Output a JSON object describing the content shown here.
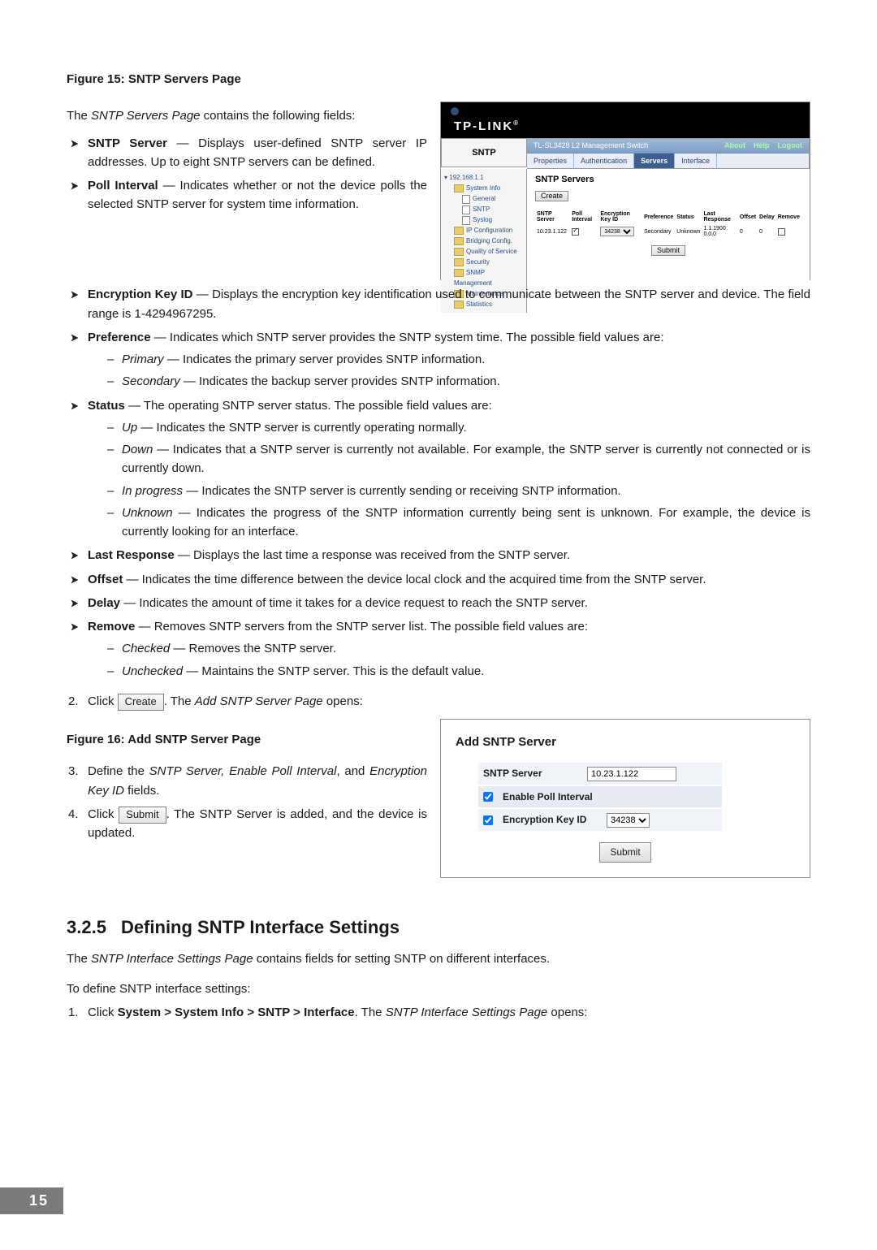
{
  "fig15_caption": "Figure 15: SNTP Servers Page",
  "intro1": "The SNTP Servers Page contains the following fields:",
  "bullets_top": {
    "server": {
      "t": "SNTP Server",
      "d": " — Displays user-defined SNTP server IP addresses. Up to eight SNTP servers can be defined."
    },
    "poll": {
      "t": "Poll Interval",
      "d": " — Indicates whether or not the device polls the selected SNTP server for system time information."
    }
  },
  "bullets_full": {
    "enc": {
      "t": "Encryption Key ID",
      "d": " — Displays the encryption key identification used to communicate between the SNTP server and device. The field range is 1-4294967295."
    },
    "pref": {
      "t": "Preference",
      "d": " — Indicates which SNTP server provides the SNTP system time. The possible field values are:",
      "sub": {
        "pri": {
          "t": "Primary",
          "d": " — Indicates the primary server provides SNTP information."
        },
        "sec": {
          "t": "Secondary",
          "d": " — Indicates the backup server provides SNTP information."
        }
      }
    },
    "status": {
      "t": "Status",
      "d": " — The operating SNTP server status. The possible field values are:",
      "sub": {
        "up": {
          "t": "Up",
          "d": " — Indicates the SNTP server is currently operating normally."
        },
        "down": {
          "t": "Down",
          "d": " — Indicates that a SNTP server is currently not available. For example, the SNTP server is currently not connected or is currently down."
        },
        "prog": {
          "t": "In progress",
          "d": " — Indicates the SNTP server is currently sending or receiving SNTP information."
        },
        "unk": {
          "t": "Unknown",
          "d": " — Indicates the progress of the SNTP information currently being sent is unknown. For example, the device is currently looking for an interface."
        }
      }
    },
    "last": {
      "t": "Last Response",
      "d": " — Displays the last time a response was received from the SNTP server."
    },
    "off": {
      "t": "Offset",
      "d": " — Indicates the time difference between the device local clock and the acquired time from the SNTP server."
    },
    "delay": {
      "t": "Delay",
      "d": " — Indicates the amount of time it takes for a device request to reach the SNTP server."
    },
    "rem": {
      "t": "Remove",
      "d": " — Removes SNTP servers from the SNTP server list. The possible field values are:",
      "sub": {
        "ch": {
          "t": "Checked",
          "d": " — Removes the SNTP server."
        },
        "un": {
          "t": "Unchecked",
          "d": " — Maintains the SNTP server. This is the default value."
        }
      }
    }
  },
  "step2": {
    "num": "2.",
    "pre": "Click ",
    "btn": "Create",
    "post": ". The Add SNTP Server Page opens:"
  },
  "fig16_caption": "Figure 16: Add SNTP Server Page",
  "step3": {
    "num": "3.",
    "text1": "Define the ",
    "em": "SNTP Server, Enable Poll Interval",
    "text2": ", and ",
    "em2": "Encryption Key ID",
    "text3": " fields."
  },
  "step4": {
    "num": "4.",
    "pre": "Click ",
    "btn": "Submit",
    "post": ". The SNTP Server is added, and the device is updated."
  },
  "section": {
    "num": "3.2.5",
    "title": "Defining SNTP Interface Settings"
  },
  "sec_body1": "The SNTP Interface Settings Page contains fields for setting SNTP on different interfaces.",
  "sec_body2": "To define SNTP interface settings:",
  "step1b": {
    "num": "1.",
    "pre": "Click ",
    "bold": "System > System Info > SNTP > Interface",
    "post": ". The SNTP Interface Settings Page opens:"
  },
  "page_number": "15",
  "shot1": {
    "brand": "TP-LINK",
    "side_label": "SNTP",
    "model": "TL-SL3428 L2 Management Switch",
    "links": {
      "about": "About",
      "help": "Help",
      "logout": "Logout"
    },
    "tabs": [
      "Properties",
      "Authentication",
      "Servers",
      "Interface"
    ],
    "active_tab_idx": 2,
    "tree": {
      "root": "192.168.1.1",
      "nodes": [
        {
          "label": "System Info",
          "cls": "folder indent1"
        },
        {
          "label": "General",
          "cls": "doc indent2"
        },
        {
          "label": "SNTP",
          "cls": "doc indent2"
        },
        {
          "label": "Syslog",
          "cls": "doc indent2"
        },
        {
          "label": "IP Configuration",
          "cls": "folder indent1"
        },
        {
          "label": "Bridging Config.",
          "cls": "folder indent1"
        },
        {
          "label": "Quality of Service",
          "cls": "folder indent1"
        },
        {
          "label": "Security",
          "cls": "folder indent1"
        },
        {
          "label": "SNMP Management",
          "cls": "folder indent1"
        },
        {
          "label": "Maintenance",
          "cls": "folder indent1"
        },
        {
          "label": "Statistics",
          "cls": "folder indent1"
        }
      ]
    },
    "heading": "SNTP Servers",
    "create_btn": "Create",
    "table": {
      "headers": [
        "SNTP Server",
        "Poll Interval",
        "Encryption Key ID",
        "Preference",
        "Status",
        "Last Response",
        "Offset",
        "Delay",
        "Remove"
      ],
      "row": {
        "server": "10.23.1.122",
        "poll_checked": true,
        "enc_key": "34238",
        "pref": "Secondary",
        "status": "Unknown",
        "last": "1.1.1900 0.0.0",
        "offset": "0",
        "delay": "0",
        "remove_checked": false
      }
    },
    "submit_btn": "Submit"
  },
  "shot2": {
    "heading": "Add SNTP Server",
    "server_label": "SNTP Server",
    "server_value": "10.23.1.122",
    "poll_label": "Enable Poll Interval",
    "poll_checked": true,
    "enc_label": "Encryption Key ID",
    "enc_checked": true,
    "enc_value": "34238",
    "submit_btn": "Submit"
  }
}
